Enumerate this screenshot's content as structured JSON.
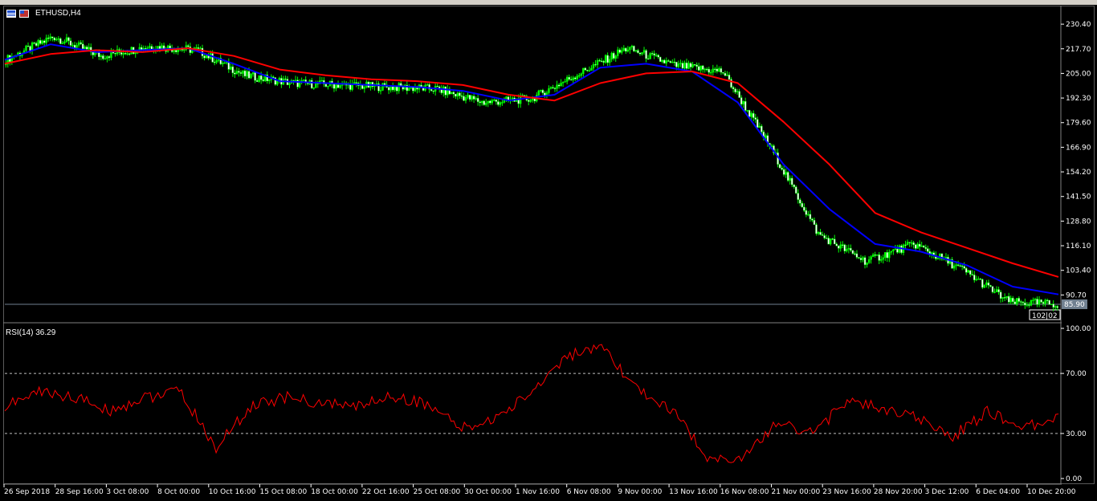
{
  "window": {
    "symbol_title": "ETHUSD,H4"
  },
  "colors": {
    "background": "#000000",
    "candle_bull": "#00ff00",
    "candle_bear": "#ffffff",
    "ma_fast": "#0000ff",
    "ma_slow": "#ff0000",
    "rsi_line": "#ff0000",
    "axis_text": "#ffffff",
    "price_line": "#708090"
  },
  "price_axis": {
    "ticks": [
      "230.40",
      "217.70",
      "205.00",
      "192.30",
      "179.60",
      "166.90",
      "154.20",
      "141.50",
      "128.80",
      "116.10",
      "103.40",
      "90.70"
    ],
    "current_price": "85.90",
    "current_time_tag": "102|02"
  },
  "rsi_panel": {
    "label": "RSI(14) 36.29",
    "ticks": [
      "100.00",
      "70.00",
      "30.00",
      "0.00"
    ]
  },
  "time_axis": {
    "labels": [
      "26 Sep 2018",
      "28 Sep 16:00",
      "3 Oct 08:00",
      "8 Oct 00:00",
      "10 Oct 16:00",
      "15 Oct 08:00",
      "18 Oct 00:00",
      "22 Oct 16:00",
      "25 Oct 08:00",
      "30 Oct 00:00",
      "1 Nov 16:00",
      "6 Nov 08:00",
      "9 Nov 00:00",
      "13 Nov 16:00",
      "16 Nov 08:00",
      "21 Nov 00:00",
      "23 Nov 16:00",
      "28 Nov 20:00",
      "3 Dec 12:00",
      "6 Dec 04:00",
      "10 Dec 20:00"
    ]
  },
  "chart_data": [
    {
      "type": "line",
      "panel": "price",
      "x_labels": [
        "26 Sep 2018",
        "28 Sep 16:00",
        "3 Oct 08:00",
        "8 Oct 00:00",
        "10 Oct 16:00",
        "15 Oct 08:00",
        "18 Oct 00:00",
        "22 Oct 16:00",
        "25 Oct 08:00",
        "30 Oct 00:00",
        "1 Nov 16:00",
        "6 Nov 08:00",
        "9 Nov 00:00",
        "13 Nov 16:00",
        "16 Nov 08:00",
        "21 Nov 00:00",
        "23 Nov 16:00",
        "28 Nov 20:00",
        "3 Dec 12:00",
        "6 Dec 04:00",
        "10 Dec 20:00"
      ],
      "ylim": [
        80.5,
        235.0
      ],
      "price_close": [
        212,
        224,
        214,
        219,
        217,
        204,
        200,
        199,
        198,
        197,
        190,
        192,
        205,
        218,
        209,
        206,
        167,
        122,
        108,
        117,
        104,
        87,
        86
      ],
      "series": [
        {
          "values": [
            212,
            220,
            216,
            217,
            218,
            210,
            201,
            200,
            199,
            198,
            196,
            191,
            194,
            208,
            210,
            206,
            190,
            158,
            135,
            117,
            113,
            106,
            95,
            91
          ]
        },
        {
          "values": [
            210,
            215,
            217,
            216,
            218,
            214,
            207,
            204,
            202,
            201,
            199,
            194,
            191,
            200,
            205,
            206,
            200,
            180,
            158,
            133,
            123,
            115,
            107,
            100
          ]
        }
      ],
      "bar_index_markers": [
        0,
        23,
        46,
        69,
        92,
        115,
        138,
        161,
        184,
        207,
        230,
        253,
        276,
        299,
        322,
        345,
        368,
        391,
        414,
        437,
        460,
        483,
        506
      ]
    },
    {
      "type": "line",
      "panel": "rsi",
      "ylim": [
        0,
        100
      ],
      "levels": [
        70,
        30
      ],
      "series": [
        {
          "values": [
            48,
            58,
            54,
            45,
            54,
            58,
            20,
            48,
            54,
            50,
            48,
            55,
            50,
            33,
            40,
            58,
            82,
            86,
            60,
            45,
            15,
            12,
            38,
            30,
            52,
            46,
            40,
            28,
            45,
            33,
            42
          ]
        }
      ]
    }
  ]
}
